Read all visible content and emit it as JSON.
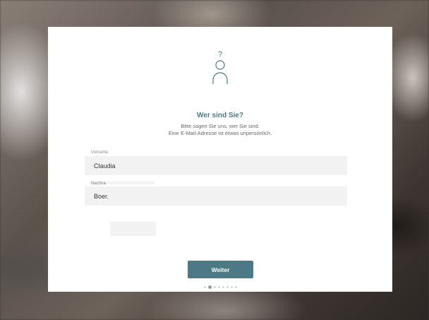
{
  "dialog": {
    "avatar_icon": "question-person-icon",
    "title": "Wer sind Sie?",
    "subtitle_line1": "Bitte sagen Sie uns, wer Sie sind.",
    "subtitle_line2": "Eine E-Mail-Adresse ist etwas unpersönlich.",
    "first_name": {
      "label": "Vorname",
      "value": "Claudia"
    },
    "last_name": {
      "label": "Nachna",
      "value": "Boer."
    },
    "next_button": "Weiter",
    "pagination": {
      "total": 8,
      "current": 2
    },
    "accent_color": "#4b7a86"
  }
}
